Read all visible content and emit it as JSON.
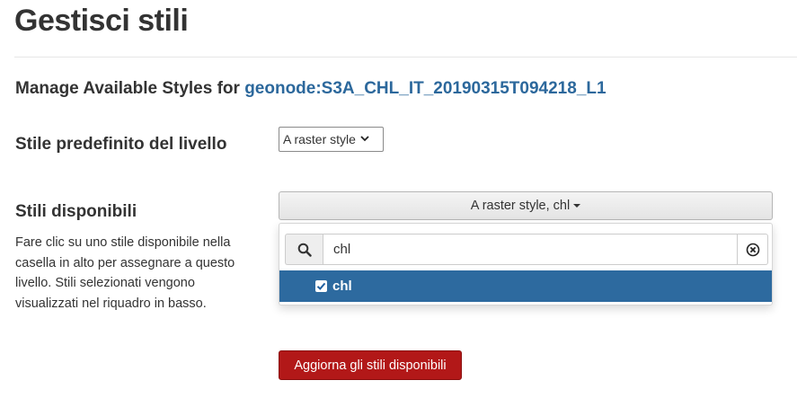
{
  "page": {
    "title": "Gestisci stili"
  },
  "manage": {
    "prefix": "Manage Available Styles for ",
    "layer_name": "geonode:S3A_CHL_IT_20190315T094218_L1"
  },
  "default_style": {
    "label": "Stile predefinito del livello",
    "selected_value": "A raster style"
  },
  "available_styles": {
    "label": "Stili disponibili",
    "help": "Fare clic su uno stile disponibile nella casella in alto per assegnare a questo livello. Stili selezionati vengono visualizzati nel riquadro in basso.",
    "button_text": "A raster style, chl",
    "search": {
      "value": "chl",
      "icon": "search-icon",
      "clear_icon": "clear-circle-icon"
    },
    "options": [
      {
        "label": "chl",
        "checked": true
      }
    ]
  },
  "submit": {
    "label": "Aggiorna gli stili disponibili"
  },
  "colors": {
    "link": "#2c689c",
    "selected_row": "#2d6a9f",
    "submit": "#b21818"
  }
}
